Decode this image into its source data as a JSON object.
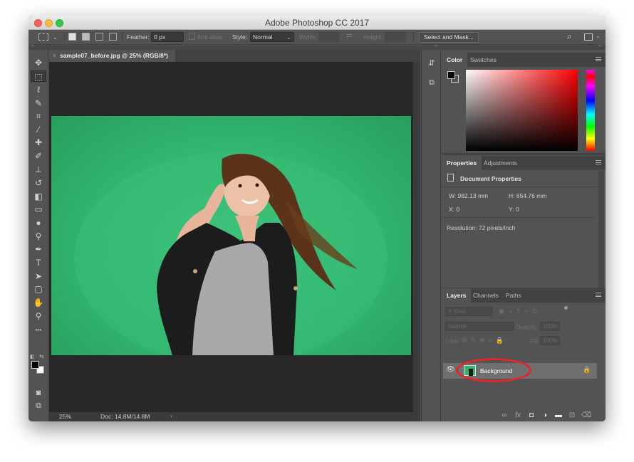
{
  "app": {
    "title": "Adobe Photoshop CC 2017"
  },
  "options_bar": {
    "feather_label": "Feather:",
    "feather_value": "0 px",
    "anti_alias_label": "Anti-alias",
    "style_label": "Style:",
    "style_value": "Normal",
    "width_label": "Width:",
    "height_label": "Height:",
    "select_mask_label": "Select and Mask..."
  },
  "document": {
    "tab_title": "sample07_before.jpg @ 25% (RGB/8*)",
    "zoom": "25%",
    "doc_size": "Doc: 14.8M/14.8M"
  },
  "tools": [
    {
      "icon": "move-icon",
      "glyph": "✥"
    },
    {
      "icon": "marquee-icon",
      "glyph": "⬚"
    },
    {
      "icon": "lasso-icon",
      "glyph": "ℓ"
    },
    {
      "icon": "quick-select-icon",
      "glyph": "✎"
    },
    {
      "icon": "crop-icon",
      "glyph": "⌗"
    },
    {
      "icon": "eyedropper-icon",
      "glyph": "⁄"
    },
    {
      "icon": "healing-brush-icon",
      "glyph": "✚"
    },
    {
      "icon": "brush-icon",
      "glyph": "✐"
    },
    {
      "icon": "clone-stamp-icon",
      "glyph": "⊥"
    },
    {
      "icon": "history-brush-icon",
      "glyph": "↺"
    },
    {
      "icon": "eraser-icon",
      "glyph": "◧"
    },
    {
      "icon": "gradient-icon",
      "glyph": "▭"
    },
    {
      "icon": "blur-icon",
      "glyph": "●"
    },
    {
      "icon": "dodge-icon",
      "glyph": "⚲"
    },
    {
      "icon": "pen-icon",
      "glyph": "✒"
    },
    {
      "icon": "type-icon",
      "glyph": "T"
    },
    {
      "icon": "path-select-icon",
      "glyph": "➤"
    },
    {
      "icon": "rectangle-icon",
      "glyph": "▢"
    },
    {
      "icon": "hand-icon",
      "glyph": "✋"
    },
    {
      "icon": "zoom-icon",
      "glyph": "⚲"
    },
    {
      "icon": "more-tools-icon",
      "glyph": "•••"
    }
  ],
  "color_panel": {
    "tabs": [
      "Color",
      "Swatches"
    ],
    "foreground": "#000000",
    "background": "#ffffff",
    "hue": "#ff0000"
  },
  "properties_panel": {
    "tabs": [
      "Properties",
      "Adjustments"
    ],
    "title": "Document Properties",
    "width": "W:  982.13 mm",
    "height": "H:  654.76 mm",
    "x": "X:  0",
    "y": "Y:  0",
    "resolution": "Resolution: 72 pixels/inch"
  },
  "layers_panel": {
    "tabs": [
      "Layers",
      "Channels",
      "Paths"
    ],
    "kind_filter": "Kind",
    "blend_mode": "Normal",
    "opacity_label": "Opacity:",
    "opacity_value": "100%",
    "lock_label": "Lock:",
    "fill_label": "Fill:",
    "fill_value": "100%",
    "layers": [
      {
        "name": "Background",
        "visible": true,
        "locked": true
      }
    ],
    "highlight_color": "#e32626"
  },
  "colors": {
    "accent": "#e32626",
    "photo_bg": "#31b56f"
  }
}
